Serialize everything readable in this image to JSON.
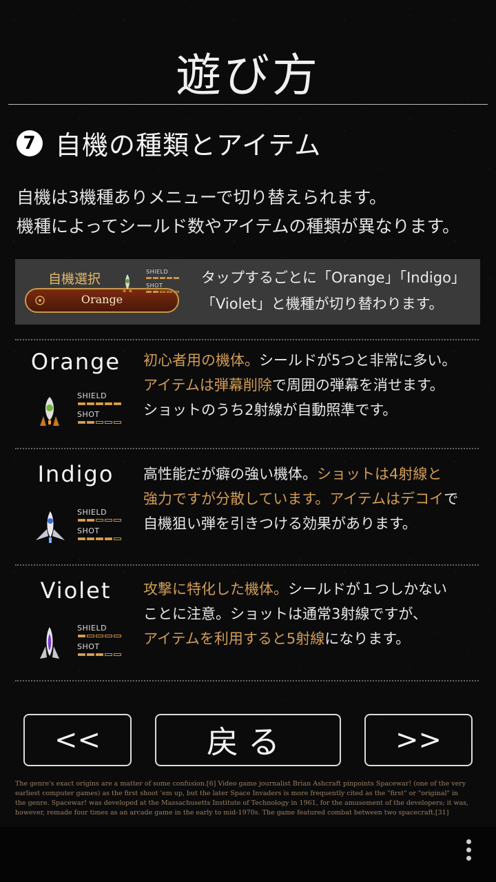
{
  "page": {
    "title": "遊び方"
  },
  "section": {
    "number": "7",
    "heading": "自機の種類とアイテム"
  },
  "intro": {
    "line1": "自機は3機種ありメニューで切り替えられます。",
    "line2": "機種によってシールド数やアイテムの種類が異なります。"
  },
  "selector": {
    "label": "自機選択",
    "button_label": "Orange",
    "shield_label": "SHIELD",
    "shot_label": "SHOT",
    "desc_line1": "タップするごとに「Orange」「Indigo」",
    "desc_line2": "「Violet」と機種が切り替わります。"
  },
  "ships": [
    {
      "name": "Orange",
      "shield_label": "SHIELD",
      "shot_label": "SHOT",
      "shield_level": 5,
      "shot_level": 2,
      "desc": {
        "l1a": "初心者用の機体。",
        "l1b": "シールドが5つと非常に多い。",
        "l2a": "アイテムは弾幕削除",
        "l2b": "で周囲の弾幕を消せます。",
        "l3": "ショットのうち2射線が自動照準です。"
      }
    },
    {
      "name": "Indigo",
      "shield_label": "SHIELD",
      "shot_label": "SHOT",
      "shield_level": 2,
      "shot_level": 4,
      "desc": {
        "l1a": "高性能だが癖の強い機体。",
        "l1b": "ショットは4射線と",
        "l2a": "強力ですが分散しています。",
        "l2b": "アイテムはデコイ",
        "l2c": "で",
        "l3": "自機狙い弾を引きつける効果があります。"
      }
    },
    {
      "name": "Violet",
      "shield_label": "SHIELD",
      "shot_label": "SHOT",
      "shield_level": 1,
      "shot_level": 3,
      "desc": {
        "l1a": "攻撃に特化した機体。",
        "l1b": "シールドが１つしかない",
        "l2": "ことに注意。ショットは通常3射線ですが、",
        "l3a": "アイテムを利用すると5射線",
        "l3b": "になります。"
      }
    }
  ],
  "nav": {
    "prev_label": "<<",
    "back_label": "戻る",
    "next_label": ">>"
  },
  "fine_print": {
    "line1": "The genre's exact origins are a matter of some confusion.[6] Video game journalist Brian Ashcraft pinpoints Spacewar! (one of the very",
    "line2": "earliest computer games) as the first shoot 'em up, but the later Space Invaders is more frequently cited as the \"first\" or \"original\" in",
    "line3": "the genre. Spacewar! was developed at the Massachusetts Institute of Technology in 1961, for the amusement of the developers; it was,",
    "line4": "however, remade four times as an arcade game in the early to mid-1970s. The game featured combat between two spacecraft.[31]"
  },
  "colors": {
    "highlight": "#d19c55",
    "bar": "#d9a352"
  },
  "icons": {
    "menu": "more-vert-icon",
    "ship": "spaceship-icon"
  }
}
